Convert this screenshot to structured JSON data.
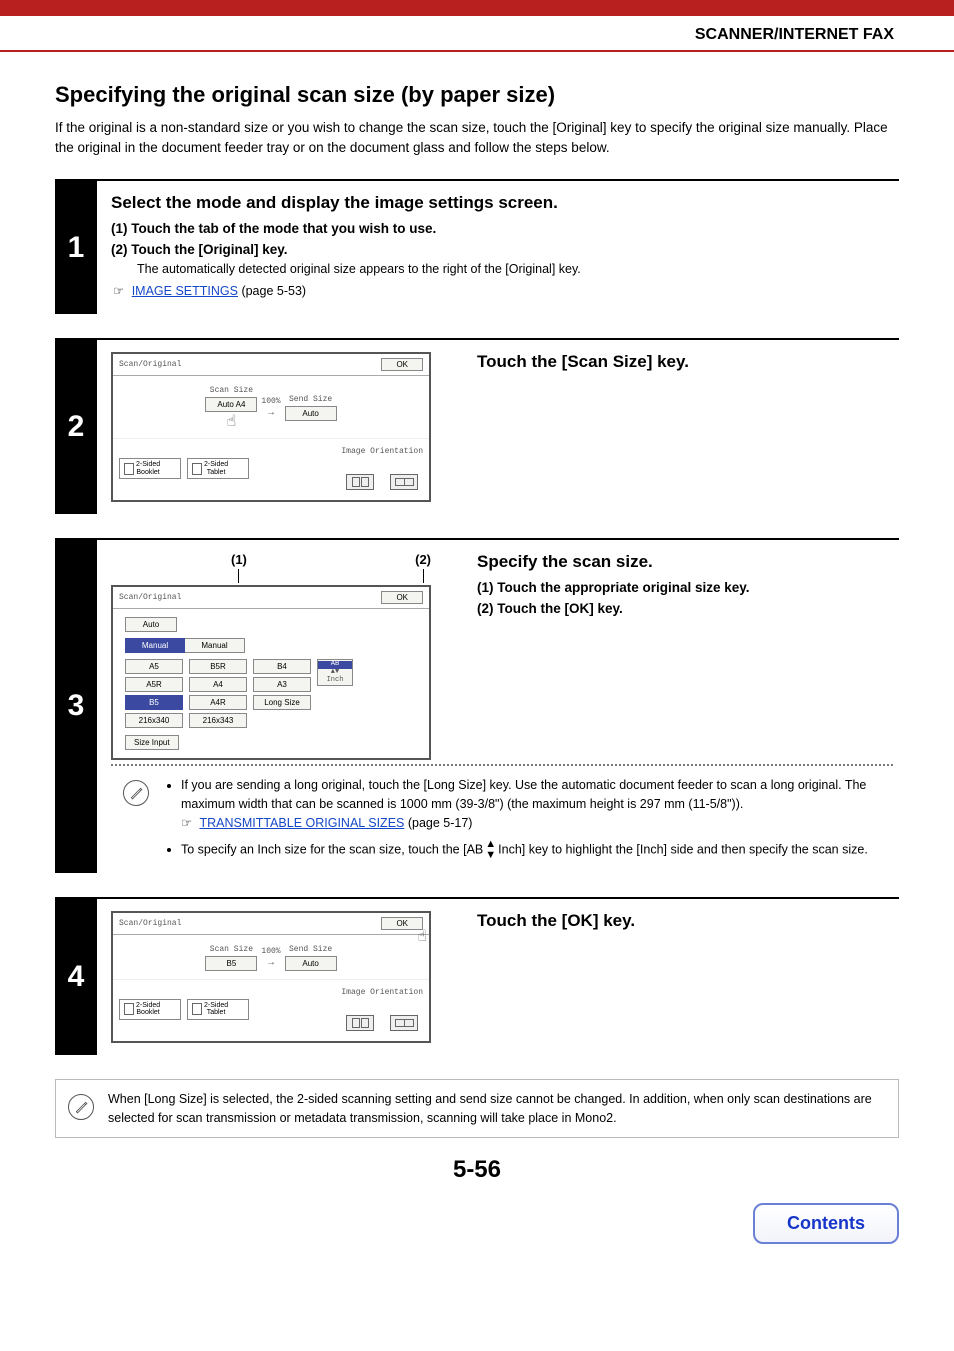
{
  "header": {
    "title": "SCANNER/INTERNET FAX"
  },
  "page_num": "5-56",
  "contents_button": "Contents",
  "h1": "Specifying the original scan size (by paper size)",
  "intro": "If the original is a non-standard size or you wish to change the scan size, touch the [Original] key to specify the original size manually. Place the original in the document feeder tray or on the document glass and follow the steps below.",
  "step1": {
    "num": "1",
    "heading": "Select the mode and display the image settings screen.",
    "item1": "(1)   Touch the tab of the mode that you wish to use.",
    "item2": "(2)   Touch the [Original] key.",
    "detected": "The automatically detected original size appears to the right of the [Original] key.",
    "link": "IMAGE SETTINGS",
    "link_page": " (page 5-53)"
  },
  "step2": {
    "num": "2",
    "heading": "Touch the [Scan Size] key.",
    "screen": {
      "title": "Scan/Original",
      "ok": "OK",
      "scan_size_lbl": "Scan Size",
      "scan_size_btn": "Auto    A4",
      "ratio": "100%",
      "send_size_lbl": "Send Size",
      "send_size_btn": "Auto",
      "img_orient": "Image Orientation",
      "tab_booklet_a": "2-Sided",
      "tab_booklet_b": "Booklet",
      "tab_tablet_a": "2-Sided",
      "tab_tablet_b": "Tablet"
    }
  },
  "step3": {
    "num": "3",
    "heading": "Specify the scan size.",
    "item1": "(1)   Touch the appropriate original size key.",
    "item2": "(2)   Touch the [OK] key.",
    "callout1": "(1)",
    "callout2": "(2)",
    "screen": {
      "title": "Scan/Original",
      "ok": "OK",
      "auto": "Auto",
      "tab_manual": "Manual",
      "tab_manual2": "Manual",
      "sizes": {
        "a5": "A5",
        "b5r": "B5R",
        "b4": "B4",
        "a5r": "A5R",
        "a4": "A4",
        "a3": "A3",
        "b5": "B5",
        "a4r": "A4R",
        "long": "Long Size",
        "x1": "216x340",
        "x2": "216x343"
      },
      "ab": "AB",
      "inch": "Inch",
      "size_input": "Size Input"
    },
    "note1_a": "If you are sending a long original, touch the [Long Size] key. Use the automatic document feeder to scan a long original. The maximum width that can be scanned is 1000 mm (39-3/8\") (the maximum height is 297 mm (11-5/8\")).",
    "note1_link": "TRANSMITTABLE ORIGINAL SIZES",
    "note1_link_page": " (page 5-17)",
    "note2_a": "To specify an Inch size for the scan size, touch the [AB",
    "note2_b": "Inch] key to highlight the [Inch] side and then specify the scan size."
  },
  "step4": {
    "num": "4",
    "heading": "Touch the [OK] key.",
    "screen": {
      "title": "Scan/Original",
      "ok": "OK",
      "scan_size_lbl": "Scan Size",
      "scan_size_btn": "B5",
      "ratio": "100%",
      "send_size_lbl": "Send Size",
      "send_size_btn": "Auto",
      "img_orient": "Image Orientation",
      "tab_booklet_a": "2-Sided",
      "tab_booklet_b": "Booklet",
      "tab_tablet_a": "2-Sided",
      "tab_tablet_b": "Tablet"
    }
  },
  "bottom_note": "When [Long Size] is selected, the 2-sided scanning setting and send size cannot be changed. In addition, when only scan destinations are selected for scan transmission or metadata transmission, scanning will take place in Mono2."
}
